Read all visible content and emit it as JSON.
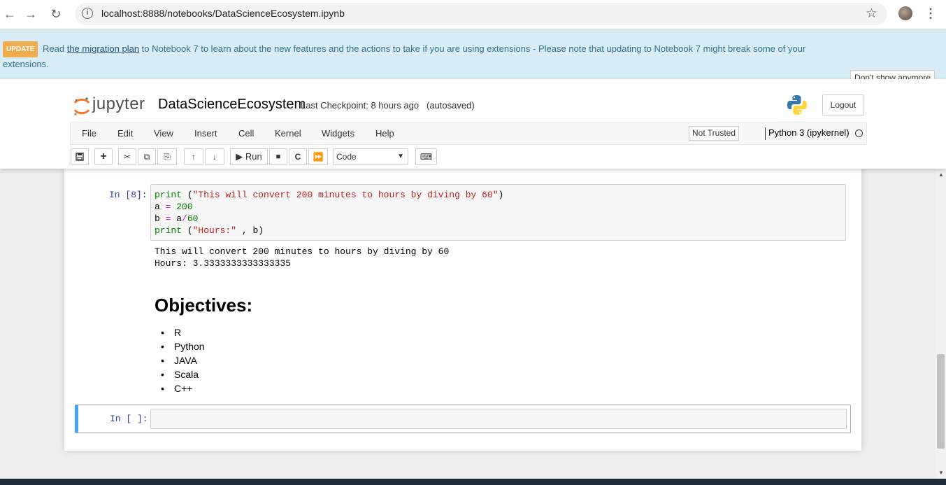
{
  "browser": {
    "url": "localhost:8888/notebooks/DataScienceEcosystem.ipynb"
  },
  "banner": {
    "badge": "UPDATE",
    "text_before": "Read",
    "link": "the migration plan",
    "text_after": "to Notebook 7 to learn about the new features and the actions to take if you are using extensions - Please note that updating to Notebook 7 might break some of your extensions.",
    "dismiss": "Don't show anymore"
  },
  "header": {
    "logo": "jupyter",
    "notebook_name": "DataScienceEcosystem",
    "checkpoint": "Last Checkpoint: 8 hours ago",
    "autosaved": "(autosaved)",
    "logout": "Logout"
  },
  "menu": {
    "items": [
      "File",
      "Edit",
      "View",
      "Insert",
      "Cell",
      "Kernel",
      "Widgets",
      "Help"
    ],
    "trust": "Not Trusted",
    "kernel": "Python 3 (ipykernel)"
  },
  "toolbar": {
    "run": "Run",
    "cell_type": "Code"
  },
  "cells": {
    "code_prompt": "In [8]:",
    "code_lines": [
      "print (\"This will convert 200 minutes to hours by diving by 60\")",
      "a = 200",
      "b = a/60",
      "print (\"Hours:\" , b)"
    ],
    "output_lines": [
      "This will convert 200 minutes to hours by diving by 60",
      "Hours: 3.3333333333333335"
    ],
    "md_title": "Objectives:",
    "md_items": [
      "R",
      "Python",
      "JAVA",
      "Scala",
      "C++"
    ],
    "empty_prompt": "In [ ]:"
  }
}
